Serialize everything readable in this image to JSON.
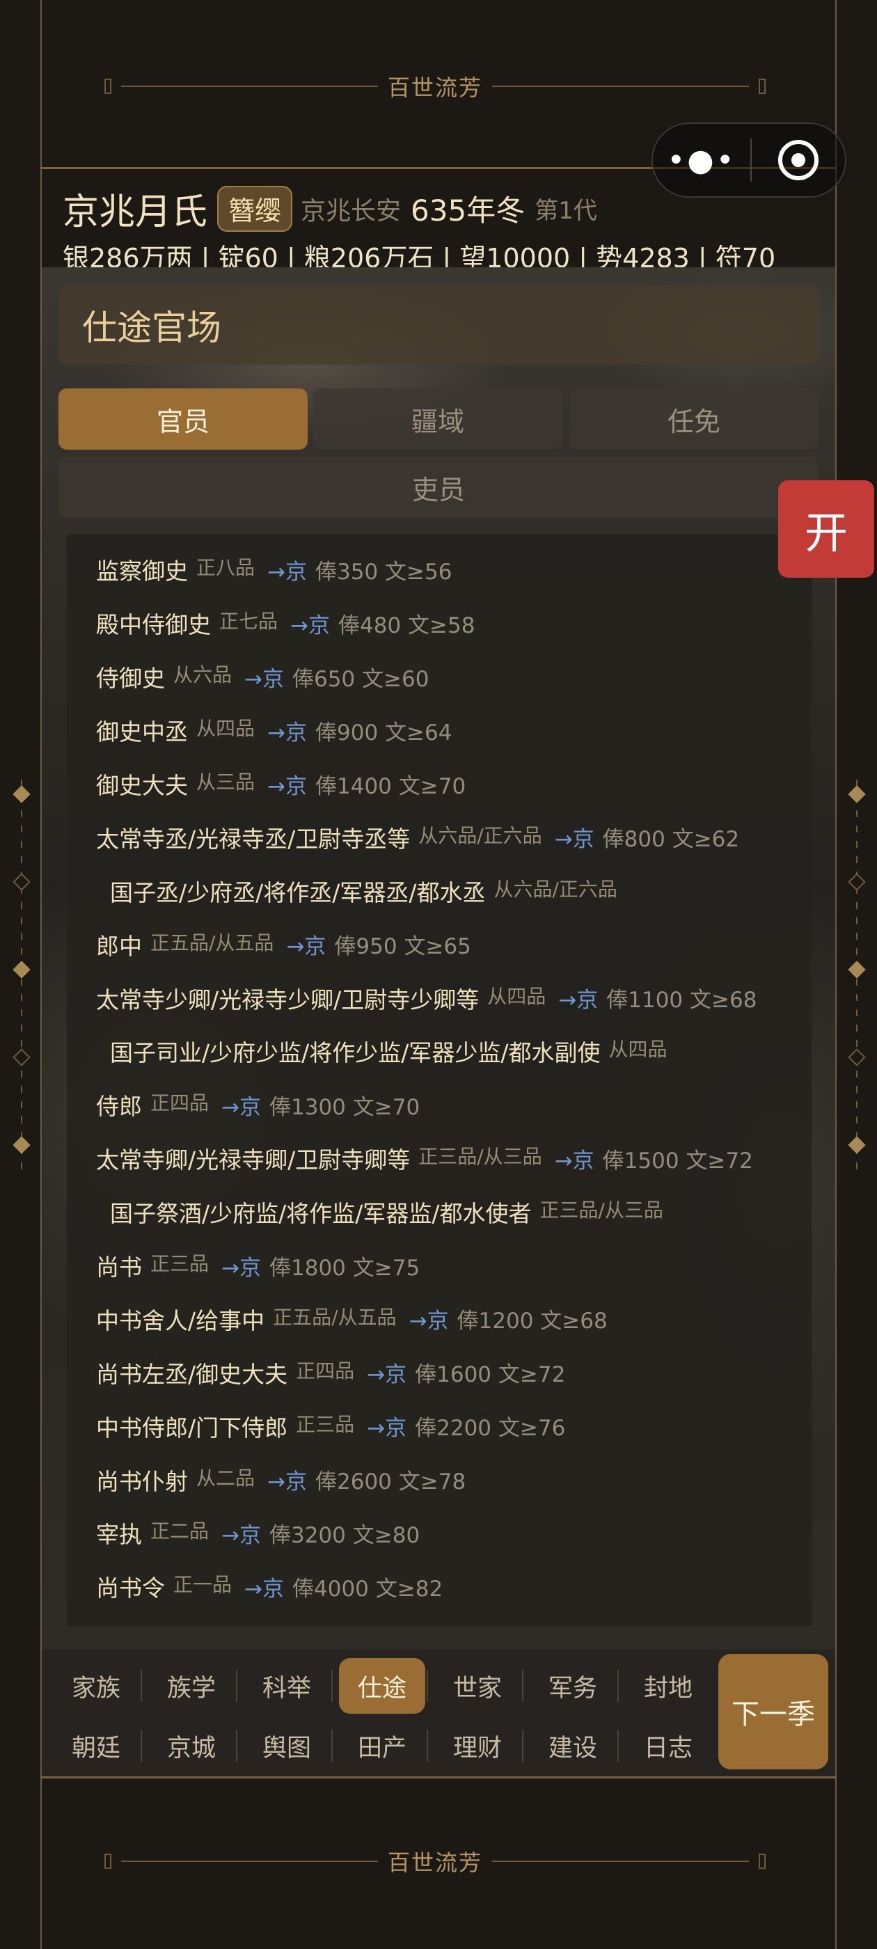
{
  "banner": {
    "title": "百世流芳"
  },
  "capsule": {
    "more_icon": "more-dots-icon",
    "close_icon": "target-circle-icon",
    "more_glyph": "•●•"
  },
  "header": {
    "clan": "京兆月氏",
    "badge": "簪缨",
    "location": "京兆长安",
    "year": "635年冬",
    "generation": "第1代",
    "stats": "银286万两 | 锭60 | 粮206万石 | 望10000 | 势4283 | 符70"
  },
  "page": {
    "title": "仕途官场",
    "tabs": [
      {
        "label": "官员",
        "active": true
      },
      {
        "label": "疆域",
        "active": false
      },
      {
        "label": "任免",
        "active": false
      },
      {
        "label": "吏员",
        "active": false
      }
    ]
  },
  "side_button": {
    "label": "开",
    "color": "#c23b37"
  },
  "offices": [
    {
      "name": "监察御史",
      "rank": "正八品",
      "dest": "→京",
      "pay": "俸350 文≥56"
    },
    {
      "name": "殿中侍御史",
      "rank": "正七品",
      "dest": "→京",
      "pay": "俸480 文≥58"
    },
    {
      "name": "侍御史",
      "rank": "从六品",
      "dest": "→京",
      "pay": "俸650 文≥60"
    },
    {
      "name": "御史中丞",
      "rank": "从四品",
      "dest": "→京",
      "pay": "俸900 文≥64"
    },
    {
      "name": "御史大夫",
      "rank": "从三品",
      "dest": "→京",
      "pay": "俸1400 文≥70"
    },
    {
      "name": "太常寺丞/光禄寺丞/卫尉寺丞等",
      "rank": "从六品/正六品",
      "dest": "→京",
      "pay": "俸800 文≥62"
    },
    {
      "name": "国子丞/少府丞/将作丞/军器丞/都水丞",
      "rank": "从六品/正六品",
      "dest": "",
      "pay": "",
      "sub": true
    },
    {
      "name": "郎中",
      "rank": "正五品/从五品",
      "dest": "→京",
      "pay": "俸950 文≥65"
    },
    {
      "name": "太常寺少卿/光禄寺少卿/卫尉寺少卿等",
      "rank": "从四品",
      "dest": "→京",
      "pay": "俸1100 文≥68"
    },
    {
      "name": "国子司业/少府少监/将作少监/军器少监/都水副使",
      "rank": "从四品",
      "dest": "",
      "pay": "",
      "sub": true
    },
    {
      "name": "侍郎",
      "rank": "正四品",
      "dest": "→京",
      "pay": "俸1300 文≥70"
    },
    {
      "name": "太常寺卿/光禄寺卿/卫尉寺卿等",
      "rank": "正三品/从三品",
      "dest": "→京",
      "pay": "俸1500 文≥72"
    },
    {
      "name": "国子祭酒/少府监/将作监/军器监/都水使者",
      "rank": "正三品/从三品",
      "dest": "",
      "pay": "",
      "sub": true
    },
    {
      "name": "尚书",
      "rank": "正三品",
      "dest": "→京",
      "pay": "俸1800 文≥75"
    },
    {
      "name": "中书舍人/给事中",
      "rank": "正五品/从五品",
      "dest": "→京",
      "pay": "俸1200 文≥68"
    },
    {
      "name": "尚书左丞/御史大夫",
      "rank": "正四品",
      "dest": "→京",
      "pay": "俸1600 文≥72"
    },
    {
      "name": "中书侍郎/门下侍郎",
      "rank": "正三品",
      "dest": "→京",
      "pay": "俸2200 文≥76"
    },
    {
      "name": "尚书仆射",
      "rank": "从二品",
      "dest": "→京",
      "pay": "俸2600 文≥78"
    },
    {
      "name": "宰执",
      "rank": "正二品",
      "dest": "→京",
      "pay": "俸3200 文≥80"
    },
    {
      "name": "尚书令",
      "rank": "正一品",
      "dest": "→京",
      "pay": "俸4000 文≥82"
    }
  ],
  "nav": {
    "row1": [
      "家族",
      "族学",
      "科举",
      "仕途",
      "世家",
      "军务",
      "封地"
    ],
    "row2": [
      "朝廷",
      "京城",
      "舆图",
      "田产",
      "理财",
      "建设",
      "日志"
    ],
    "active": "仕途",
    "next_label": "下一季"
  },
  "colors": {
    "accent": "#9a6d34",
    "gold_text": "#e8cf9c",
    "dest_blue": "#6f96d0",
    "background": "#1c1915"
  }
}
